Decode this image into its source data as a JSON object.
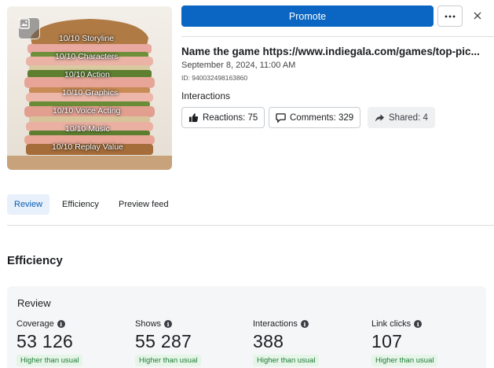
{
  "header": {
    "promote_label": "Promote",
    "more_label": "···",
    "close_label": "✕"
  },
  "thumbnail": {
    "lines": [
      "10/10 Storyline",
      "10/10 Characters",
      "10/10 Action",
      "10/10 Graphics",
      "10/10 Voice Acting",
      "10/10 Music",
      "10/10 Replay Value"
    ]
  },
  "post": {
    "title": "Name the game https://www.indiegala.com/games/top-pic...",
    "date": "September 8, 2024, 11:00 AM",
    "id": "ID: 940032498163860"
  },
  "interactions": {
    "title": "Interactions",
    "reactions": "Reactions: 75",
    "comments": "Comments: 329",
    "shared": "Shared: 4"
  },
  "tabs": [
    "Review",
    "Efficiency",
    "Preview feed"
  ],
  "efficiency": {
    "section_title": "Efficiency",
    "card_title": "Review",
    "metrics": [
      {
        "label": "Coverage",
        "value": "53 126",
        "badge": "Higher than usual"
      },
      {
        "label": "Shows",
        "value": "55 287",
        "badge": "Higher than usual"
      },
      {
        "label": "Interactions",
        "value": "388",
        "badge": "Higher than usual"
      },
      {
        "label": "Link clicks",
        "value": "107",
        "badge": "Higher than usual"
      }
    ]
  },
  "colors": {
    "accent": "#0a66c2",
    "positive_badge_bg": "#e5f5e8",
    "positive_badge_text": "#1e7b34"
  },
  "icons": {
    "thumb_badge": "gallery-icon",
    "more": "more-dots-icon",
    "close": "close-icon",
    "reactions": "thumbs-up-icon",
    "comments": "comment-icon",
    "shared": "share-arrow-icon",
    "info": "info-icon"
  }
}
